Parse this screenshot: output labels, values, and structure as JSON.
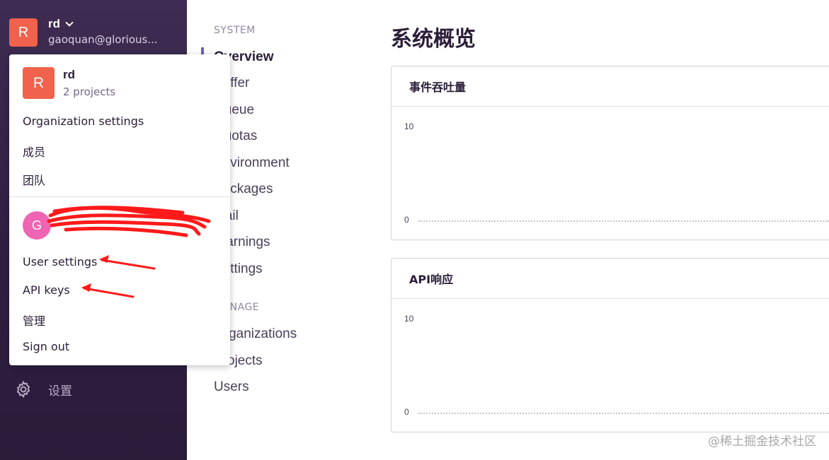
{
  "sidebar": {
    "org_initial": "R",
    "org_name": "rd",
    "org_email": "gaoquan@glorious...",
    "settings_label": "设置"
  },
  "dropdown": {
    "org_initial": "R",
    "org_name": "rd",
    "org_projects": "2 projects",
    "org_items": [
      "Organization settings",
      "成员",
      "团队"
    ],
    "user_initial": "G",
    "user_items": [
      "User settings",
      "API keys",
      "管理",
      "Sign out"
    ]
  },
  "nav": {
    "system_title": "SYSTEM",
    "system_items": [
      "Overview",
      "Buffer",
      "Queue",
      "Quotas",
      "Environment",
      "Packages",
      "Mail",
      "Warnings",
      "Settings"
    ],
    "manage_title": "MANAGE",
    "manage_items": [
      "Organizations",
      "Projects",
      "Users"
    ],
    "active": "Overview"
  },
  "main": {
    "title": "系统概览",
    "panels": [
      {
        "title": "事件吞吐量",
        "y_max_label": "10",
        "y_min_label": "0"
      },
      {
        "title": "API响应",
        "y_max_label": "10",
        "y_min_label": "0"
      }
    ]
  },
  "watermark": "@稀土掘金技术社区",
  "colors": {
    "sidebar_bg": "#3e2c52",
    "org_avatar": "#f0624b",
    "user_avatar": "#f064b4",
    "accent": "#6c5fc7",
    "annotation": "#ff1a1a"
  }
}
